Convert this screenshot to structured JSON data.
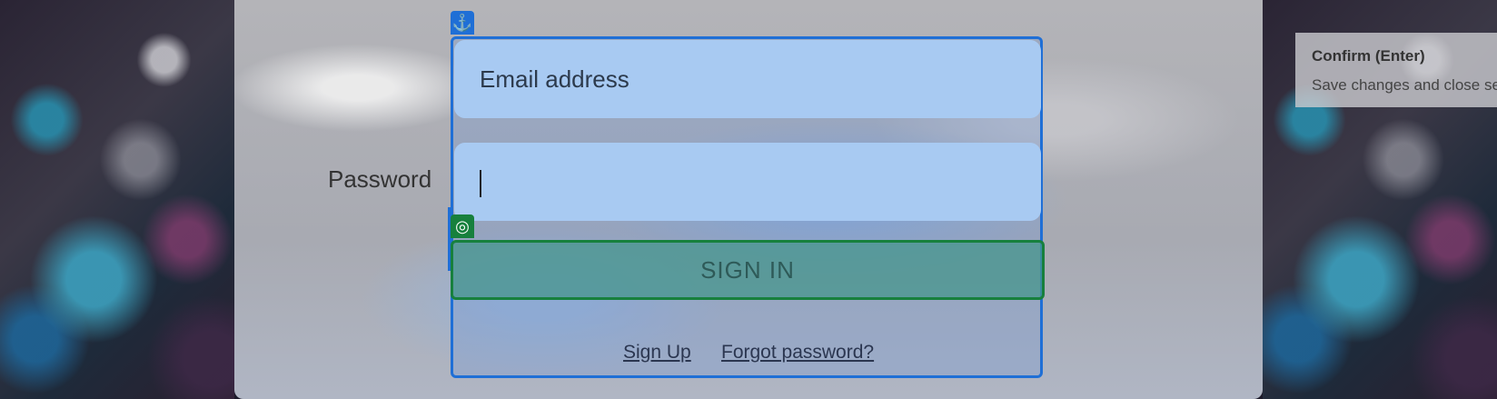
{
  "form": {
    "password_label": "Password",
    "email_placeholder": "Email address",
    "password_value": "",
    "signin_label": "SIGN IN",
    "signup_link": "Sign Up",
    "forgot_link": "Forgot password?"
  },
  "tooltip": {
    "title": "Confirm (Enter)",
    "description": "Save changes and close se"
  },
  "icons": {
    "anchor": "anchor-icon",
    "target": "target-icon"
  },
  "colors": {
    "selection_blue": "#1f6fd6",
    "selection_green": "#17803d",
    "field_bg": "#a8caf2"
  }
}
